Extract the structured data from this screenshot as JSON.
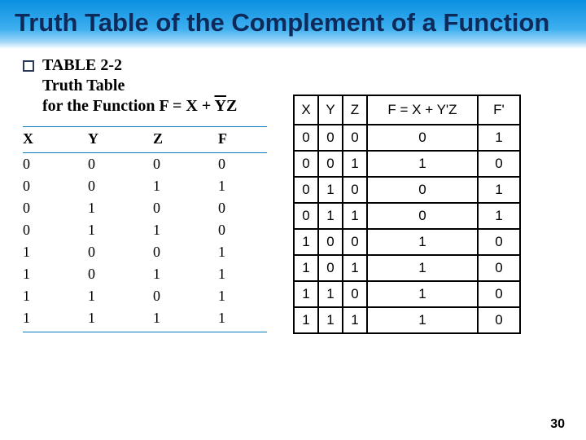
{
  "title": "Truth Table of the Complement of a Function",
  "caption_line1": "TABLE 2-2",
  "caption_line2": "Truth Table",
  "caption_line3_prefix": "for the Function F = X + ",
  "caption_line3_ybar": "Y",
  "caption_line3_suffix": "Z",
  "left_headers": [
    "X",
    "Y",
    "Z",
    "F"
  ],
  "right_headers": [
    "X",
    "Y",
    "Z",
    "F = X + Y'Z",
    "F'"
  ],
  "left_rows": [
    [
      "0",
      "0",
      "0",
      "0"
    ],
    [
      "0",
      "0",
      "1",
      "1"
    ],
    [
      "0",
      "1",
      "0",
      "0"
    ],
    [
      "0",
      "1",
      "1",
      "0"
    ],
    [
      "1",
      "0",
      "0",
      "1"
    ],
    [
      "1",
      "0",
      "1",
      "1"
    ],
    [
      "1",
      "1",
      "0",
      "1"
    ],
    [
      "1",
      "1",
      "1",
      "1"
    ]
  ],
  "right_rows": [
    [
      "0",
      "0",
      "0",
      "0",
      "1"
    ],
    [
      "0",
      "0",
      "1",
      "1",
      "0"
    ],
    [
      "0",
      "1",
      "0",
      "0",
      "1"
    ],
    [
      "0",
      "1",
      "1",
      "0",
      "1"
    ],
    [
      "1",
      "0",
      "0",
      "1",
      "0"
    ],
    [
      "1",
      "0",
      "1",
      "1",
      "0"
    ],
    [
      "1",
      "1",
      "0",
      "1",
      "0"
    ],
    [
      "1",
      "1",
      "1",
      "1",
      "0"
    ]
  ],
  "page_number": "30",
  "chart_data": {
    "type": "table",
    "title": "Truth Table of the Complement of a Function",
    "columns": [
      "X",
      "Y",
      "Z",
      "F = X + Y'Z",
      "F'"
    ],
    "rows": [
      [
        0,
        0,
        0,
        0,
        1
      ],
      [
        0,
        0,
        1,
        1,
        0
      ],
      [
        0,
        1,
        0,
        0,
        1
      ],
      [
        0,
        1,
        1,
        0,
        1
      ],
      [
        1,
        0,
        0,
        1,
        0
      ],
      [
        1,
        0,
        1,
        1,
        0
      ],
      [
        1,
        1,
        0,
        1,
        0
      ],
      [
        1,
        1,
        1,
        1,
        0
      ]
    ]
  }
}
